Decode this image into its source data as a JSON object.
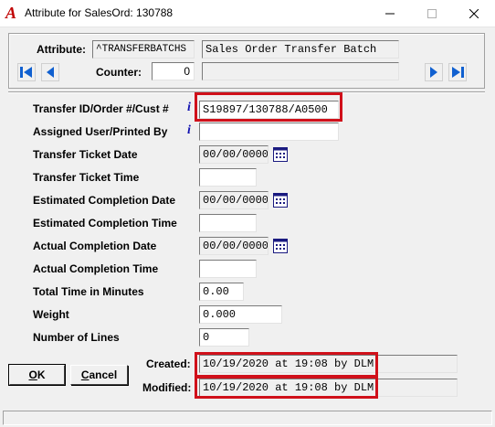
{
  "window": {
    "title": "Attribute for SalesOrd: 130788",
    "minimize_glyph": "—",
    "maximize_glyph": "☐",
    "close_glyph": "✕"
  },
  "header": {
    "attribute_label": "Attribute:",
    "attribute_code": "^TRANSFERBATCHS",
    "attribute_description": "Sales Order Transfer Batch",
    "counter_label": "Counter:",
    "counter_value": "0",
    "counter_extra": ""
  },
  "fields": [
    {
      "label": "Transfer ID/Order #/Cust #",
      "value": "S19897/130788/A0500",
      "info": true
    },
    {
      "label": "Assigned User/Printed By",
      "value": "",
      "info": true
    },
    {
      "label": "Transfer Ticket Date",
      "value": "00/00/0000"
    },
    {
      "label": "Transfer Ticket Time",
      "value": ""
    },
    {
      "label": "Estimated Completion Date",
      "value": "00/00/0000"
    },
    {
      "label": "Estimated Completion Time",
      "value": ""
    },
    {
      "label": "Actual Completion Date",
      "value": "00/00/0000"
    },
    {
      "label": "Actual Completion Time",
      "value": ""
    },
    {
      "label": "Total Time in Minutes",
      "value": "0.00"
    },
    {
      "label": "Weight",
      "value": "0.000"
    },
    {
      "label": "Number of Lines",
      "value": "0"
    }
  ],
  "info_glyph": "i",
  "audit": {
    "created_label": "Created:",
    "created_value": "10/19/2020 at 19:08 by DLM",
    "modified_label": "Modified:",
    "modified_value": "10/19/2020 at 19:08 by DLM"
  },
  "buttons": {
    "ok_accel": "O",
    "ok_rest": "K",
    "cancel_accel": "C",
    "cancel_rest": "ancel"
  },
  "colors": {
    "highlight": "#d0101a",
    "nav_arrow": "#1060d0",
    "info_icon": "#1010b0",
    "app_icon": "#c00000"
  }
}
